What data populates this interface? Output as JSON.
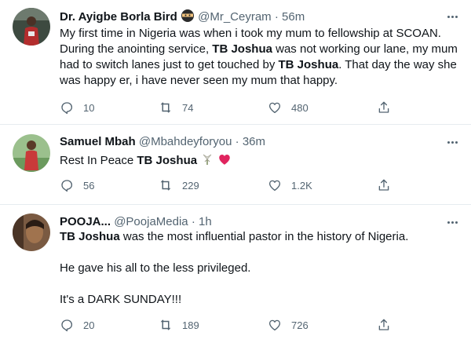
{
  "tweets": [
    {
      "name": "Dr. Ayigbe Borla Bird",
      "handle": "@Mr_Ceyram",
      "sep": "·",
      "time": "56m",
      "text": {
        "t1": "My first time in Nigeria was when i took my mum to fellowship at SCOAN. During the anointing service, ",
        "b1": "TB Joshua",
        "t2": " was not working our lane, my mum had to switch lanes just to get touched by ",
        "b2": "TB Joshua",
        "t3": ". That day the way she was happy er, i have never seen my mum that happy."
      },
      "replies": "10",
      "retweets": "74",
      "likes": "480"
    },
    {
      "name": "Samuel Mbah",
      "handle": "@Mbahdeyforyou",
      "sep": "·",
      "time": "36m",
      "text": {
        "t1": "Rest In Peace ",
        "b1": "TB Joshua"
      },
      "replies": "56",
      "retweets": "229",
      "likes": "1.2K"
    },
    {
      "name": "POOJA...",
      "handle": "@PoojaMedia",
      "sep": "·",
      "time": "1h",
      "text": {
        "b1": "TB Joshua",
        "t1": " was the most influential pastor in the history of Nigeria.",
        "p2": "He gave his all to the less privileged.",
        "p3": "It's a DARK SUNDAY!!!"
      },
      "replies": "20",
      "retweets": "189",
      "likes": "726"
    }
  ],
  "colors": {
    "text": "#0f1419",
    "secondary": "#536471",
    "border": "#e6ecf0",
    "heart": "#e0245e"
  }
}
